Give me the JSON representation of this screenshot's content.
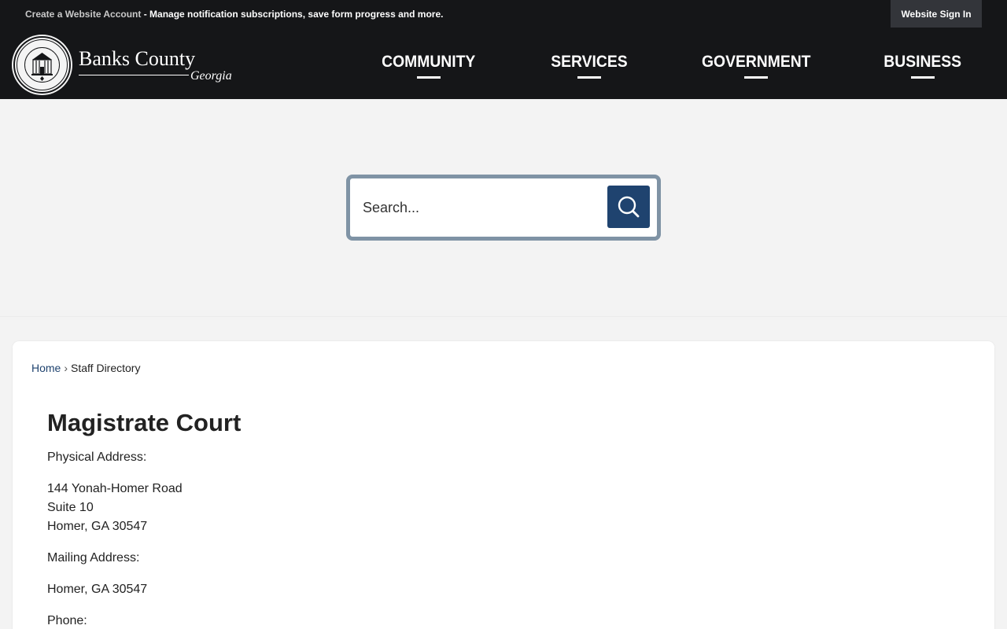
{
  "topbar": {
    "create_account": "Create a Website Account",
    "account_message": " - Manage notification subscriptions, save form progress and more.",
    "sign_in": "Website Sign In"
  },
  "logo": {
    "name": "Banks County",
    "state": "Georgia",
    "seal_text_top": "BANKS COUNTY",
    "seal_text_bottom": "ESTABLISHED 1858"
  },
  "nav": {
    "items": [
      {
        "label": "COMMUNITY"
      },
      {
        "label": "SERVICES"
      },
      {
        "label": "GOVERNMENT"
      },
      {
        "label": "BUSINESS"
      }
    ]
  },
  "search": {
    "placeholder": "Search...",
    "icon": "search-icon"
  },
  "breadcrumb": {
    "home": "Home",
    "separator": "›",
    "current": "Staff Directory"
  },
  "department": {
    "title": "Magistrate Court",
    "physical_label": "Physical Address:",
    "physical_line1": "144 Yonah-Homer Road",
    "physical_line2": "Suite 10",
    "physical_line3": "Homer, GA 30547",
    "mailing_label": "Mailing Address:",
    "mailing_line1": "Homer, GA 30547",
    "phone_label": "Phone:"
  },
  "colors": {
    "header_bg": "#151618",
    "accent": "#1f436f",
    "search_border": "#7f93a5",
    "page_bg": "#f3f3f3"
  }
}
